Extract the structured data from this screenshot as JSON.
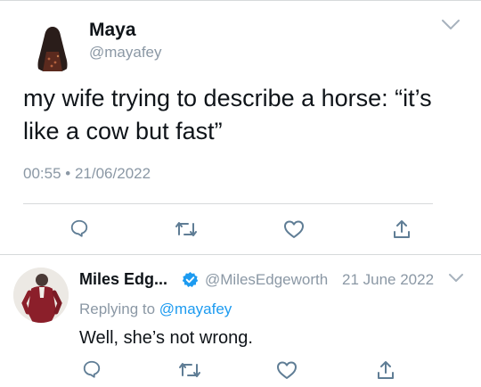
{
  "tweet": {
    "author_name": "Maya",
    "author_handle": "@mayafey",
    "text": "my wife trying to describe a horse: “it’s like a cow but fast”",
    "time": "00:55",
    "separator": "•",
    "date": "21/06/2022",
    "actions": [
      "reply-icon",
      "retweet-icon",
      "like-icon",
      "share-icon"
    ]
  },
  "reply": {
    "author_name": "Miles Edg...",
    "author_handle": "@MilesEdgeworth",
    "date": "21 June 2022",
    "replying_prefix": "Replying to",
    "replying_handle": "@mayafey",
    "text": "Well, she’s not wrong.",
    "actions": [
      "reply-icon",
      "retweet-icon",
      "like-icon",
      "share-icon"
    ]
  },
  "colors": {
    "link": "#1d9bf0",
    "muted": "#8b98a5",
    "icon": "#5f7d95"
  }
}
